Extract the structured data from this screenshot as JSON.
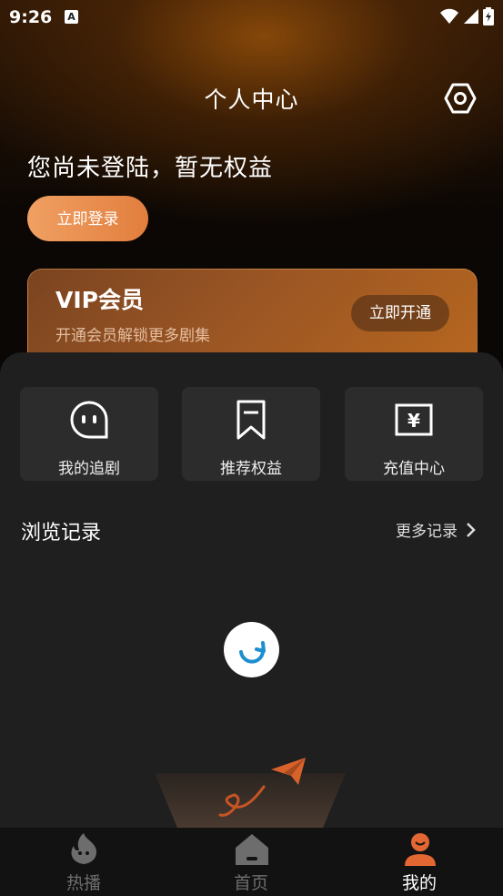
{
  "status": {
    "time": "9:26",
    "notification_badge": "A"
  },
  "header": {
    "title": "个人中心",
    "settings_icon": "settings-hex-icon"
  },
  "login": {
    "hint": "您尚未登陆，暂无权益",
    "button": "立即登录"
  },
  "vip": {
    "title": "VIP会员",
    "subtitle": "开通会员解锁更多剧集",
    "button": "立即开通"
  },
  "features": [
    {
      "label": "我的追剧",
      "icon": "chat-bubble-face-icon"
    },
    {
      "label": "推荐权益",
      "icon": "bookmark-icon"
    },
    {
      "label": "充值中心",
      "icon": "yen-box-icon"
    }
  ],
  "history": {
    "title": "浏览记录",
    "more": "更多记录"
  },
  "tabs": [
    {
      "label": "热播",
      "icon": "flame-icon",
      "active": false
    },
    {
      "label": "首页",
      "icon": "home-icon",
      "active": false
    },
    {
      "label": "我的",
      "icon": "profile-icon",
      "active": true
    }
  ],
  "colors": {
    "accent": "#e6773a",
    "tab_active": "#e26733",
    "tab_inactive": "#6d6d6d"
  }
}
